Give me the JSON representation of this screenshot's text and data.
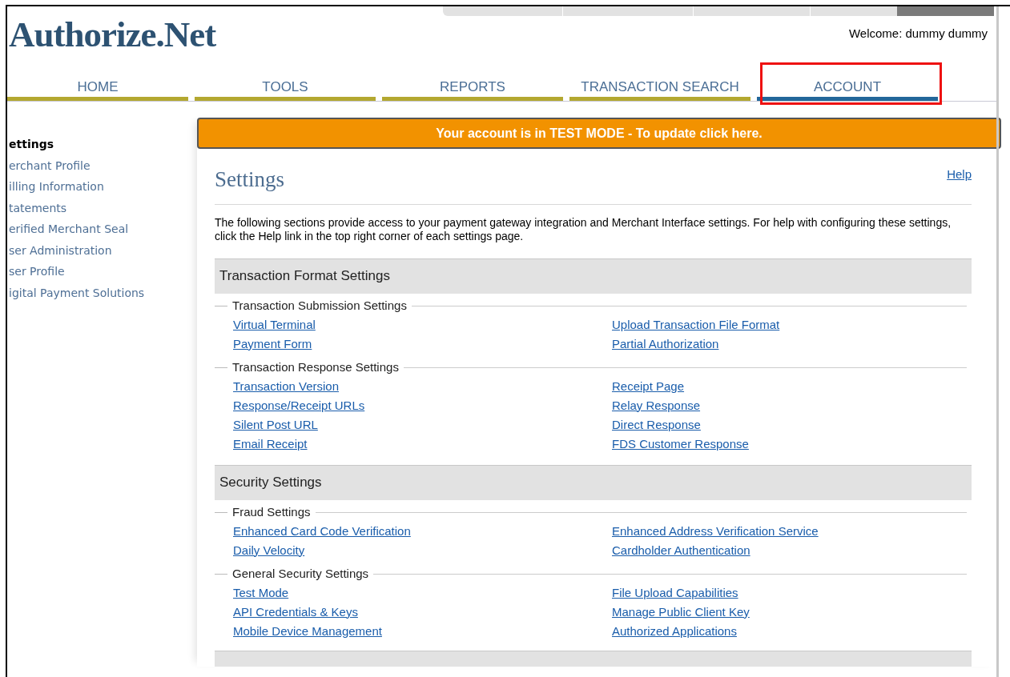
{
  "logo": "Authorize.Net",
  "welcome": "Welcome: dummy dummy",
  "nav": [
    {
      "label": "HOME",
      "selected": false
    },
    {
      "label": "TOOLS",
      "selected": false
    },
    {
      "label": "REPORTS",
      "selected": false
    },
    {
      "label": "TRANSACTION SEARCH",
      "selected": false
    },
    {
      "label": "ACCOUNT",
      "selected": true
    }
  ],
  "sidebar": [
    {
      "label": "ettings",
      "selected": true
    },
    {
      "label": "erchant Profile",
      "selected": false
    },
    {
      "label": "illing Information",
      "selected": false
    },
    {
      "label": "tatements",
      "selected": false
    },
    {
      "label": "erified Merchant Seal",
      "selected": false
    },
    {
      "label": "ser Administration",
      "selected": false
    },
    {
      "label": "ser Profile",
      "selected": false
    },
    {
      "label": "igital Payment Solutions",
      "selected": false
    }
  ],
  "banner": "Your account is in TEST MODE - To update click here.",
  "title": "Settings",
  "help": "Help",
  "intro": "The following sections provide access to your payment gateway integration and Merchant Interface settings. For help with configuring these settings, click the Help link in the top right corner of each settings page.",
  "sections": [
    {
      "title": "Transaction Format Settings",
      "groups": [
        {
          "title": "Transaction Submission Settings",
          "left": [
            "Virtual Terminal",
            "Payment Form"
          ],
          "right": [
            "Upload Transaction File Format",
            "Partial Authorization"
          ]
        },
        {
          "title": "Transaction Response Settings",
          "left": [
            "Transaction Version",
            "Response/Receipt URLs",
            "Silent Post URL",
            "Email Receipt"
          ],
          "right": [
            "Receipt Page",
            "Relay Response",
            "Direct Response",
            "FDS Customer Response"
          ]
        }
      ]
    },
    {
      "title": "Security Settings",
      "groups": [
        {
          "title": "Fraud Settings",
          "left": [
            "Enhanced Card Code Verification",
            "Daily Velocity"
          ],
          "right": [
            "Enhanced Address Verification Service",
            "Cardholder Authentication"
          ]
        },
        {
          "title": "General Security Settings",
          "left": [
            "Test Mode",
            "API Credentials & Keys",
            "Mobile Device Management"
          ],
          "right": [
            "File Upload Capabilities",
            "Manage Public Client Key",
            "Authorized Applications"
          ]
        }
      ]
    }
  ]
}
